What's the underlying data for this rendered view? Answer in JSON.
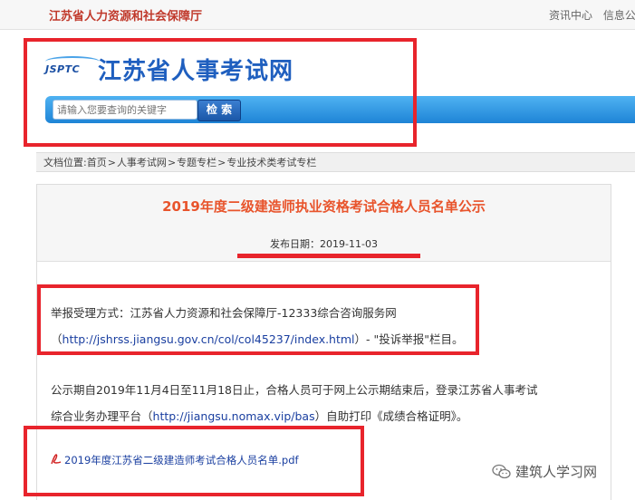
{
  "top": {
    "org_name": "江苏省人力资源和社会保障厅",
    "nav": [
      "资讯中心",
      "信息公开"
    ]
  },
  "header": {
    "logo_abbr": "JSPTC",
    "site_title": "江苏省人事考试网",
    "search_placeholder": "请输入您要查询的关键字",
    "search_button": "检 索"
  },
  "breadcrumb": {
    "prefix": "文档位置:",
    "items": [
      "首页",
      "人事考试网",
      "专题专栏",
      "专业技术类考试专栏"
    ],
    "sep": ">"
  },
  "article": {
    "title": "2019年度二级建造师执业资格考试合格人员名单公示",
    "date_label": "发布日期：",
    "date": "2019-11-03",
    "report": {
      "line1": "举报受理方式：江苏省人力资源和社会保障厅-12333综合咨询服务网",
      "paren_open": "（",
      "url": "http://jshrss.jiangsu.gov.cn/col/col45237/index.html",
      "line2_tail": "）- \"投诉举报\"栏目。"
    },
    "notice": {
      "line1": "公示期自2019年11月4日至11月18日止，合格人员可于网上公示期结束后，登录江苏省人事考试",
      "line2_head": "综合业务办理平台（",
      "url": "http://jiangsu.nomax.vip/bas",
      "line2_tail": "）自助打印《成绩合格证明》。"
    },
    "attachment": "2019年度江苏省二级建造师考试合格人员名单.pdf"
  },
  "watermark": "建筑人学习网",
  "colors": {
    "accent_red": "#e8242c",
    "title_orange": "#e8542c",
    "link_blue": "#1a3fa0"
  }
}
